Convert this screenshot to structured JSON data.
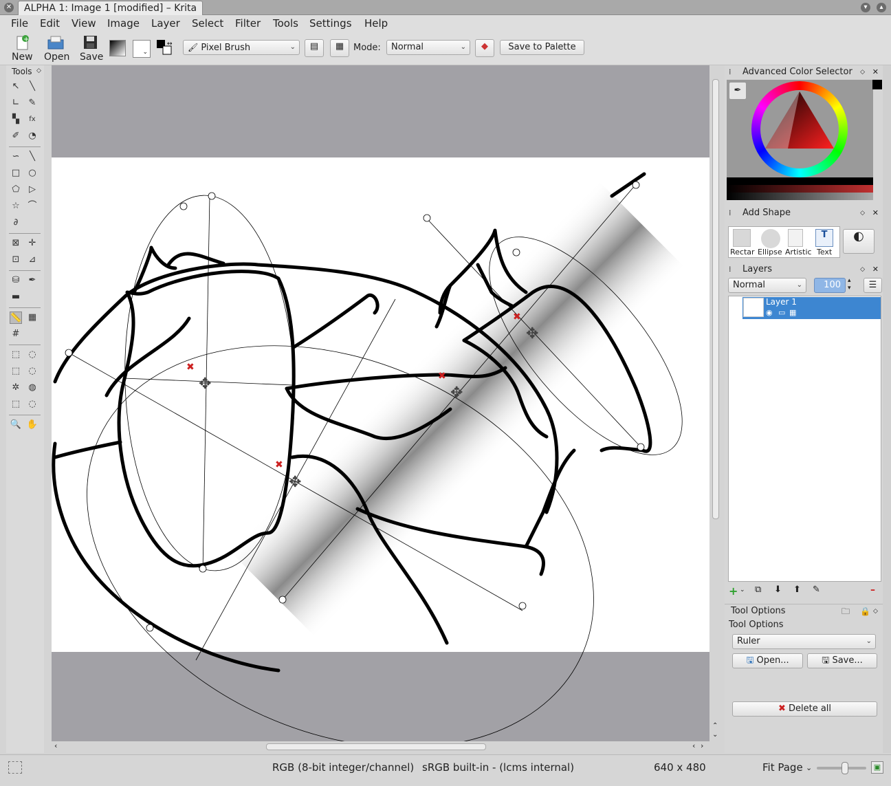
{
  "window": {
    "title": "ALPHA 1: Image 1 [modified] – Krita"
  },
  "menu": [
    "File",
    "Edit",
    "View",
    "Image",
    "Layer",
    "Select",
    "Filter",
    "Tools",
    "Settings",
    "Help"
  ],
  "toolbar": {
    "new_label": "New",
    "open_label": "Open",
    "save_label": "Save",
    "brush_preset": "Pixel Brush",
    "mode_label": "Mode:",
    "mode_value": "Normal",
    "save_palette_label": "Save to Palette"
  },
  "toolbox": {
    "title": "Tools"
  },
  "dockers": {
    "color_selector": {
      "title": "Advanced Color Selector"
    },
    "add_shape": {
      "title": "Add Shape",
      "shapes": [
        "Rectar",
        "Ellipse",
        "Artistic",
        "Text"
      ]
    },
    "layers": {
      "title": "Layers",
      "blend_mode": "Normal",
      "opacity": "100",
      "items": [
        {
          "name": "Layer 1"
        }
      ]
    },
    "tool_options": {
      "title": "Tool Options",
      "subtitle": "Tool Options",
      "tool_value": "Ruler",
      "open_label": "Open...",
      "save_label": "Save...",
      "delete_all_label": "Delete all"
    }
  },
  "statusbar": {
    "colorspace": "RGB (8-bit integer/channel)",
    "profile": "sRGB built-in - (lcms internal)",
    "dimensions": "640 x 480",
    "zoom": "Fit Page"
  },
  "colors": {
    "selection_blue": "#3d86d1",
    "canvas_bg": "#a2a1a6",
    "accent_red": "#cc2020"
  }
}
